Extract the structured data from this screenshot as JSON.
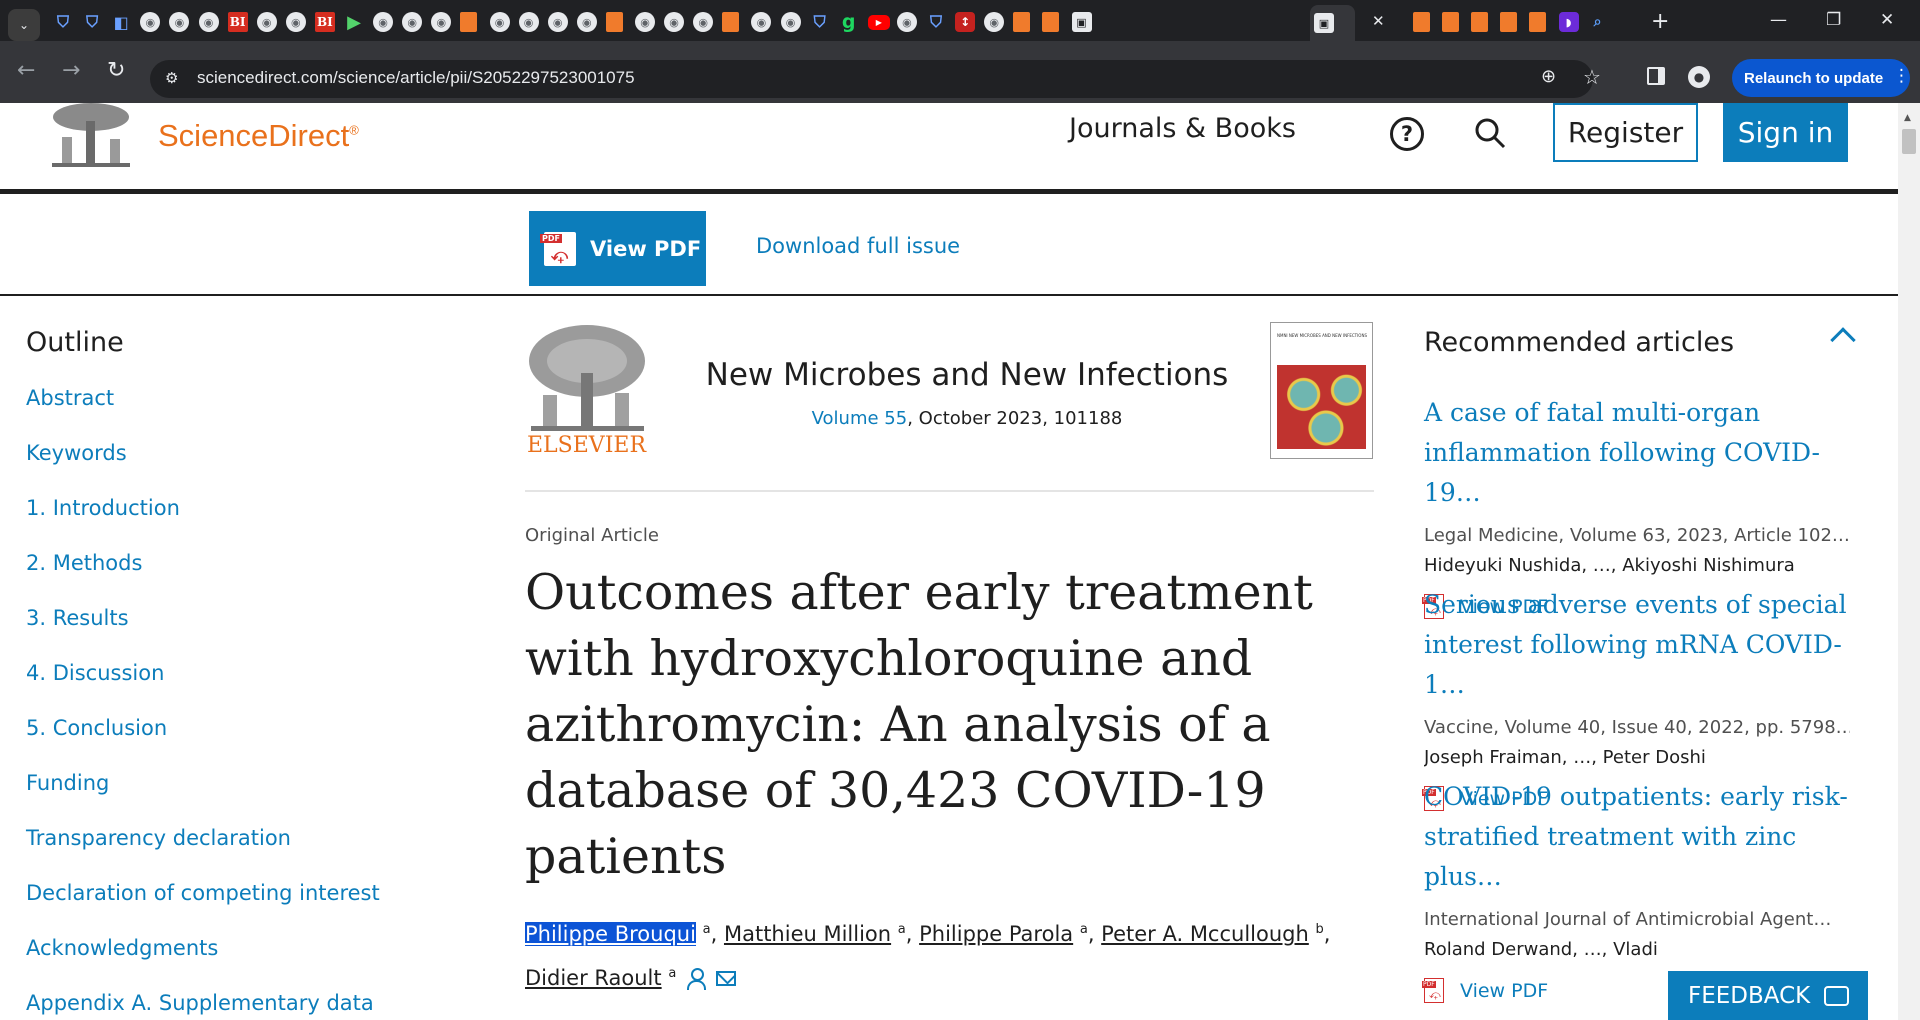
{
  "browser": {
    "url": "sciencedirect.com/science/article/pii/S2052297523001075",
    "relaunch_label": "Relaunch to update",
    "tab_icons": [
      "shield-tab",
      "shield-tab",
      "doc-tab",
      "globe-tab",
      "globe-tab",
      "globe-tab",
      "bi-tab",
      "globe-tab",
      "globe-tab",
      "bi-tab",
      "play-tab",
      "globe-tab",
      "globe-tab",
      "globe-tab",
      "book-tab",
      "globe-tab",
      "globe-tab",
      "globe-tab",
      "globe-tab",
      "book-tab",
      "globe-tab",
      "globe-tab",
      "globe-tab",
      "book-tab",
      "globe-tab",
      "globe-tab",
      "shield-tab",
      "goodreads-tab",
      "youtube-tab",
      "globe-tab",
      "shield-tab",
      "red-tab",
      "globe-tab",
      "book-tab",
      "book-tab",
      "gallery-tab",
      "book-tab",
      "book-tab",
      "book-tab",
      "book-tab",
      "book-tab",
      "purple-tab",
      "search-tab"
    ]
  },
  "site": {
    "brand": "ScienceDirect",
    "brand_mark": "®",
    "nav_journals": "Journals & Books",
    "register": "Register",
    "sign_in": "Sign in",
    "accent": "#0c7dbb",
    "brand_color": "#e9711c"
  },
  "toolbar": {
    "view_pdf": "View PDF",
    "download_issue": "Download full issue"
  },
  "outline": {
    "title": "Outline",
    "items": [
      "Abstract",
      "Keywords",
      "1. Introduction",
      "2. Methods",
      "3. Results",
      "4. Discussion",
      "5. Conclusion",
      "Funding",
      "Transparency declaration",
      "Declaration of competing interest",
      "Acknowledgments",
      "Appendix A. Supplementary data"
    ]
  },
  "article": {
    "publisher": "ELSEVIER",
    "journal": "New Microbes and New Infections",
    "volume_link": "Volume 55",
    "issue_rest": ", October 2023, 101188",
    "cover_text": "NMNI NEW MICROBES AND NEW INFECTIONS",
    "type": "Original Article",
    "title": "Outcomes after early treatment with hydroxychloroquine and azithromycin: An analysis of a database of 30,423 COVID-19 patients",
    "authors": [
      {
        "name": "Philippe Brouqui",
        "sup": "a",
        "sep": ", "
      },
      {
        "name": "Matthieu Million",
        "sup": "a",
        "sep": ", "
      },
      {
        "name": "Philippe Parola",
        "sup": "a",
        "sep": ", "
      },
      {
        "name": "Peter A. Mccullough",
        "sup": "b",
        "sep": ","
      },
      {
        "name": "Didier Raoult",
        "sup": "a",
        "sep": ""
      }
    ]
  },
  "recommended": {
    "title": "Recommended articles",
    "items": [
      {
        "title": "A case of fatal multi-organ inflammation following COVID-19…",
        "meta": "Legal Medicine, Volume 63, 2023, Article 102…",
        "authors": "Hideyuki Nushida, …, Akiyoshi Nishimura",
        "pdf": "View PDF"
      },
      {
        "title": "Serious adverse events of special interest following mRNA COVID-1…",
        "meta": "Vaccine, Volume 40, Issue 40, 2022, pp. 5798…",
        "authors": "Joseph Fraiman, …, Peter Doshi",
        "pdf": "View PDF"
      },
      {
        "title": "COVID-19 outpatients: early risk-stratified treatment with zinc plus…",
        "meta": "International Journal of Antimicrobial Agent…",
        "authors": "Roland Derwand, …, Vladi",
        "pdf": "View PDF"
      }
    ]
  },
  "feedback_label": "FEEDBACK"
}
